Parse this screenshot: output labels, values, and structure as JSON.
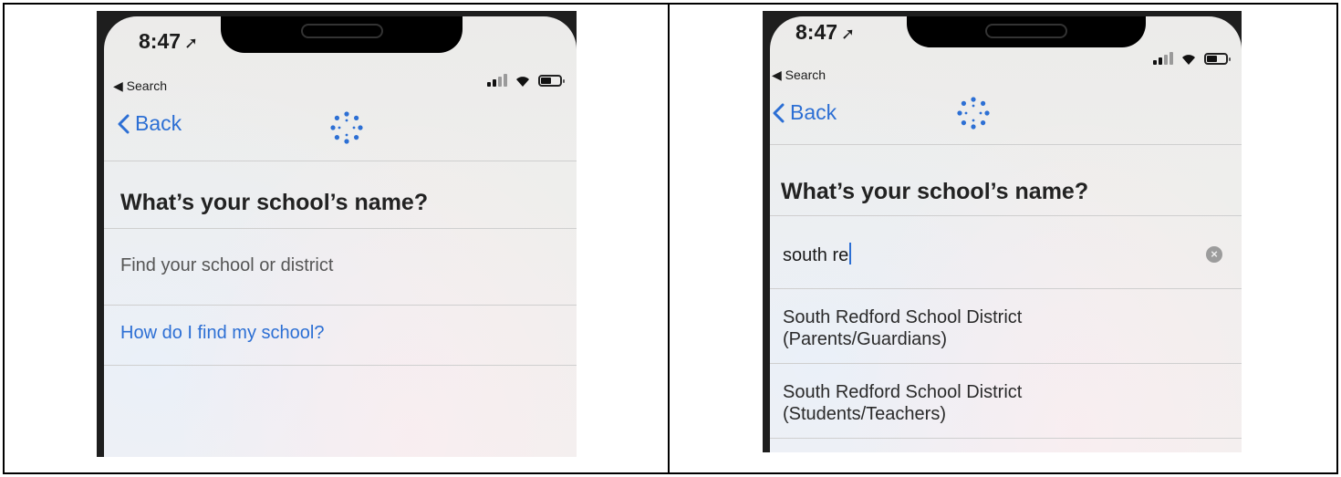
{
  "status_bar": {
    "time": "8:47",
    "location_glyph": "➚",
    "back_app_label": "◀ Search"
  },
  "nav": {
    "back_label": "Back",
    "logo_icon": "canvas-logo-icon",
    "accent_color": "#2c6fd4"
  },
  "left_screen": {
    "heading": "What’s your school’s name?",
    "search_placeholder": "Find your school or district",
    "help_link": "How do I find my school?"
  },
  "right_screen": {
    "heading": "What’s your school’s name?",
    "search_value": "south re",
    "results": [
      {
        "line1": "South Redford School District",
        "line2": "(Parents/Guardians)"
      },
      {
        "line1": "South Redford School District",
        "line2": "(Students/Teachers)"
      }
    ]
  }
}
